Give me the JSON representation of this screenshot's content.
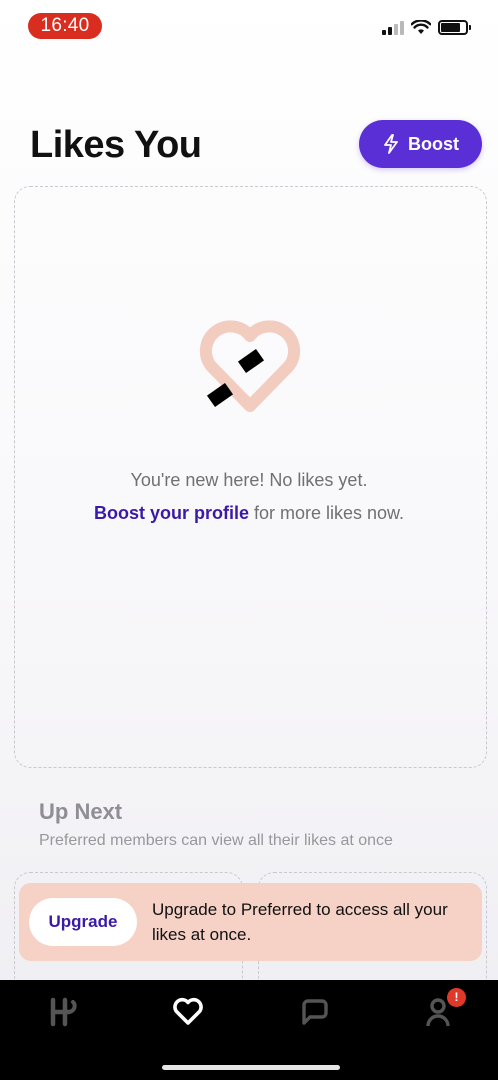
{
  "status_bar": {
    "time": "16:40",
    "icons": [
      "signal-icon",
      "wifi-icon",
      "battery-icon"
    ]
  },
  "header": {
    "title": "Likes You",
    "boost_label": "Boost",
    "boost_icon": "lightning-icon"
  },
  "likes_card": {
    "illustration": "broken-heart-icon",
    "empty_message": "You're new here! No likes yet.",
    "boost_link": "Boost your profile",
    "boost_suffix": " for more likes now."
  },
  "up_next": {
    "title": "Up Next",
    "subtitle": "Preferred members can view all their likes at once"
  },
  "upgrade_banner": {
    "button_label": "Upgrade",
    "message": "Upgrade to Preferred to access all your likes at once."
  },
  "bottom_nav": {
    "items": [
      {
        "name": "discover-icon",
        "active": false
      },
      {
        "name": "likes-heart-icon",
        "active": true
      },
      {
        "name": "chat-icon",
        "active": false
      },
      {
        "name": "profile-icon",
        "active": false
      }
    ],
    "profile_badge": "!"
  },
  "colors": {
    "accent": "#5a2fd6",
    "link": "#3b1aa8",
    "banner": "#f5d1c6",
    "badge": "#e0392a",
    "heart": "#f2cdbf"
  }
}
